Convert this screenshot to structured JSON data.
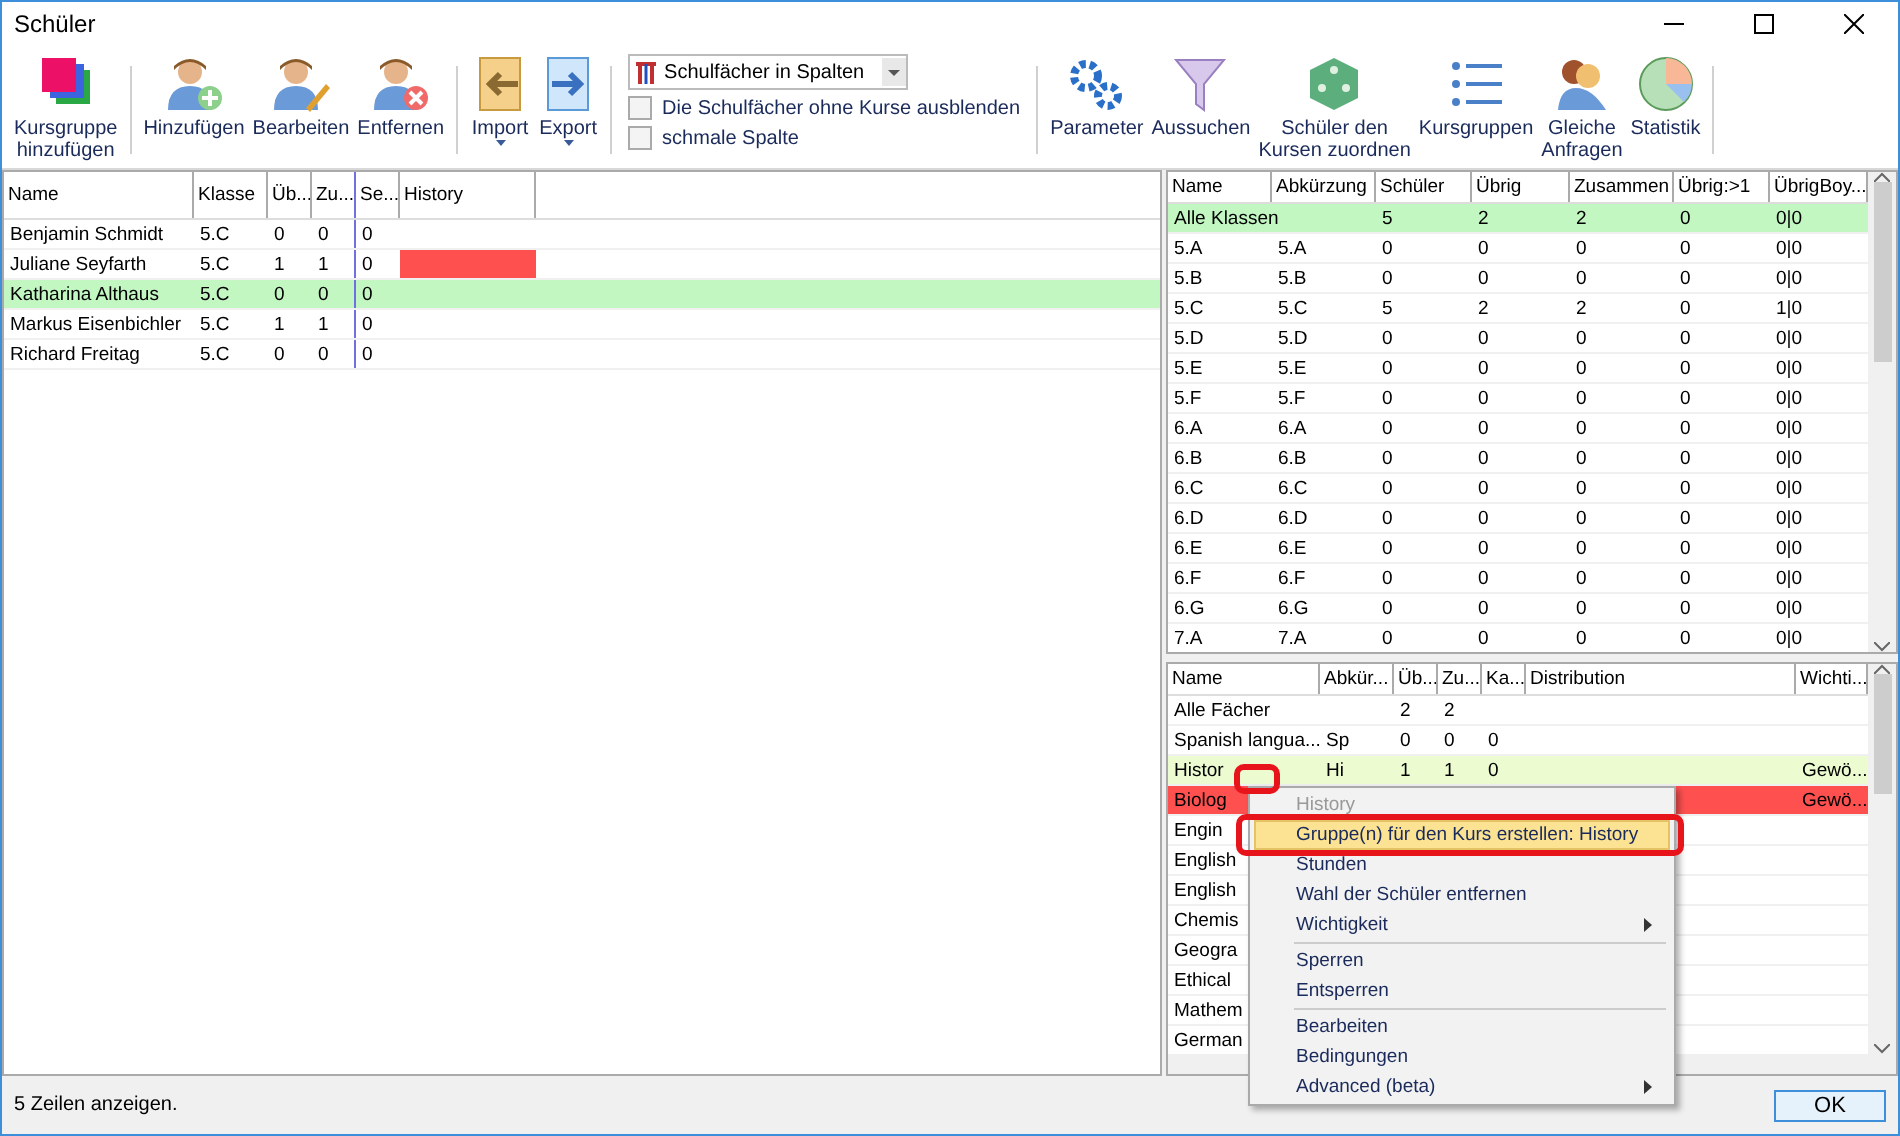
{
  "window": {
    "title": "Schüler"
  },
  "toolbar": {
    "groups": [
      [
        {
          "label": "Kursgruppe\nhinzufügen",
          "dropdown": false
        }
      ],
      [
        {
          "label": "Hinzufügen",
          "dropdown": false
        },
        {
          "label": "Bearbeiten",
          "dropdown": false
        },
        {
          "label": "Entfernen",
          "dropdown": false
        }
      ],
      [
        {
          "label": "Import",
          "dropdown": true
        },
        {
          "label": "Export",
          "dropdown": true
        }
      ]
    ],
    "view_select": {
      "value": "Schulfächer in Spalten"
    },
    "checkboxes": [
      {
        "label": "Die Schulfächer ohne Kurse ausblenden",
        "checked": false
      },
      {
        "label": "schmale Spalte",
        "checked": false
      }
    ],
    "groups_right": [
      {
        "label": "Parameter",
        "dropdown": false
      },
      {
        "label": "Aussuchen",
        "dropdown": false
      },
      {
        "label": "Schüler den\nKursen zuordnen",
        "dropdown": false
      },
      {
        "label": "Kursgruppen",
        "dropdown": false
      },
      {
        "label": "Gleiche\nAnfragen",
        "dropdown": false
      },
      {
        "label": "Statistik",
        "dropdown": false
      }
    ]
  },
  "students": {
    "columns": [
      "Name",
      "Klasse",
      "Üb...",
      "Zu...",
      "Se...",
      "History"
    ],
    "rows": [
      {
        "cells": [
          "Benjamin Schmidt",
          "5.C",
          "0",
          "0",
          "0"
        ],
        "selected": false
      },
      {
        "cells": [
          "Juliane Seyfarth",
          "5.C",
          "1",
          "1",
          "0"
        ],
        "selected": false,
        "history": {
          "color": "#ff5050"
        }
      },
      {
        "cells": [
          "Katharina Althaus",
          "5.C",
          "0",
          "0",
          "0"
        ],
        "selected": true
      },
      {
        "cells": [
          "Markus Eisenbichler",
          "5.C",
          "1",
          "1",
          "0"
        ],
        "selected": false
      },
      {
        "cells": [
          "Richard Freitag",
          "5.C",
          "0",
          "0",
          "0"
        ],
        "selected": false
      }
    ]
  },
  "classes": {
    "columns": [
      "Name",
      "Abkürzung",
      "Schüler",
      "Übrig",
      "Zusammen",
      "Übrig:>1",
      "ÜbrigBoy..."
    ],
    "rows": [
      {
        "cells": [
          "Alle Klassen",
          "",
          "5",
          "2",
          "2",
          "0",
          "0|0"
        ],
        "selected": true
      },
      {
        "cells": [
          "5.A",
          "5.A",
          "0",
          "0",
          "0",
          "0",
          "0|0"
        ],
        "selected": false
      },
      {
        "cells": [
          "5.B",
          "5.B",
          "0",
          "0",
          "0",
          "0",
          "0|0"
        ],
        "selected": false
      },
      {
        "cells": [
          "5.C",
          "5.C",
          "5",
          "2",
          "2",
          "0",
          "1|0"
        ],
        "selected": false
      },
      {
        "cells": [
          "5.D",
          "5.D",
          "0",
          "0",
          "0",
          "0",
          "0|0"
        ],
        "selected": false
      },
      {
        "cells": [
          "5.E",
          "5.E",
          "0",
          "0",
          "0",
          "0",
          "0|0"
        ],
        "selected": false
      },
      {
        "cells": [
          "5.F",
          "5.F",
          "0",
          "0",
          "0",
          "0",
          "0|0"
        ],
        "selected": false
      },
      {
        "cells": [
          "6.A",
          "6.A",
          "0",
          "0",
          "0",
          "0",
          "0|0"
        ],
        "selected": false
      },
      {
        "cells": [
          "6.B",
          "6.B",
          "0",
          "0",
          "0",
          "0",
          "0|0"
        ],
        "selected": false
      },
      {
        "cells": [
          "6.C",
          "6.C",
          "0",
          "0",
          "0",
          "0",
          "0|0"
        ],
        "selected": false
      },
      {
        "cells": [
          "6.D",
          "6.D",
          "0",
          "0",
          "0",
          "0",
          "0|0"
        ],
        "selected": false
      },
      {
        "cells": [
          "6.E",
          "6.E",
          "0",
          "0",
          "0",
          "0",
          "0|0"
        ],
        "selected": false
      },
      {
        "cells": [
          "6.F",
          "6.F",
          "0",
          "0",
          "0",
          "0",
          "0|0"
        ],
        "selected": false
      },
      {
        "cells": [
          "6.G",
          "6.G",
          "0",
          "0",
          "0",
          "0",
          "0|0"
        ],
        "selected": false
      },
      {
        "cells": [
          "7.A",
          "7.A",
          "0",
          "0",
          "0",
          "0",
          "0|0"
        ],
        "selected": false
      }
    ]
  },
  "subjects": {
    "columns": [
      "Name",
      "Abkür...",
      "Üb...",
      "Zu...",
      "Ka...",
      "Distribution",
      "Wichti..."
    ],
    "rows": [
      {
        "cells": [
          "Alle Fächer",
          "",
          "2",
          "2",
          "",
          "",
          ""
        ]
      },
      {
        "cells": [
          "Spanish langua...",
          "Sp",
          "0",
          "0",
          "0",
          "",
          ""
        ]
      },
      {
        "cells": [
          "Histor",
          "Hi",
          "1",
          "1",
          "0",
          "",
          "Gewö..."
        ],
        "color": "#ecfcd0"
      },
      {
        "cells": [
          "Biolog",
          "",
          "",
          "",
          "",
          "",
          "Gewö..."
        ],
        "color": "#ff5050"
      },
      {
        "cells": [
          "Engin",
          "",
          "",
          "",
          "",
          "",
          ""
        ]
      },
      {
        "cells": [
          "English",
          "",
          "",
          "",
          "",
          "",
          ""
        ]
      },
      {
        "cells": [
          "English",
          "",
          "",
          "",
          "",
          "",
          ""
        ]
      },
      {
        "cells": [
          "Chemis",
          "",
          "",
          "",
          "",
          "",
          ""
        ]
      },
      {
        "cells": [
          "Geogra",
          "",
          "",
          "",
          "",
          "",
          ""
        ]
      },
      {
        "cells": [
          "Ethical",
          "",
          "",
          "",
          "",
          "",
          ""
        ]
      },
      {
        "cells": [
          "Mathem",
          "",
          "",
          "",
          "",
          "",
          ""
        ]
      },
      {
        "cells": [
          "German",
          "",
          "",
          "",
          "",
          "",
          ""
        ]
      }
    ]
  },
  "context_menu": {
    "items": [
      {
        "kind": "header",
        "label": "History"
      },
      {
        "kind": "item",
        "label": "Gruppe(n) für den Kurs erstellen: History",
        "highlighted": true,
        "submenu": false
      },
      {
        "kind": "item",
        "label": "Stunden",
        "highlighted": false,
        "submenu": false
      },
      {
        "kind": "item",
        "label": "Wahl der Schüler entfernen",
        "highlighted": false,
        "submenu": false
      },
      {
        "kind": "item",
        "label": "Wichtigkeit",
        "highlighted": false,
        "submenu": true
      },
      {
        "kind": "separator"
      },
      {
        "kind": "item",
        "label": "Sperren",
        "highlighted": false,
        "submenu": false
      },
      {
        "kind": "item",
        "label": "Entsperren",
        "highlighted": false,
        "submenu": false
      },
      {
        "kind": "separator"
      },
      {
        "kind": "item",
        "label": "Bearbeiten",
        "highlighted": false,
        "submenu": false
      },
      {
        "kind": "item",
        "label": "Bedingungen",
        "highlighted": false,
        "submenu": false
      },
      {
        "kind": "item",
        "label": "Advanced (beta)",
        "highlighted": false,
        "submenu": true
      }
    ]
  },
  "status_bar": {
    "text": "5 Zeilen anzeigen.",
    "ok_button": "OK"
  }
}
